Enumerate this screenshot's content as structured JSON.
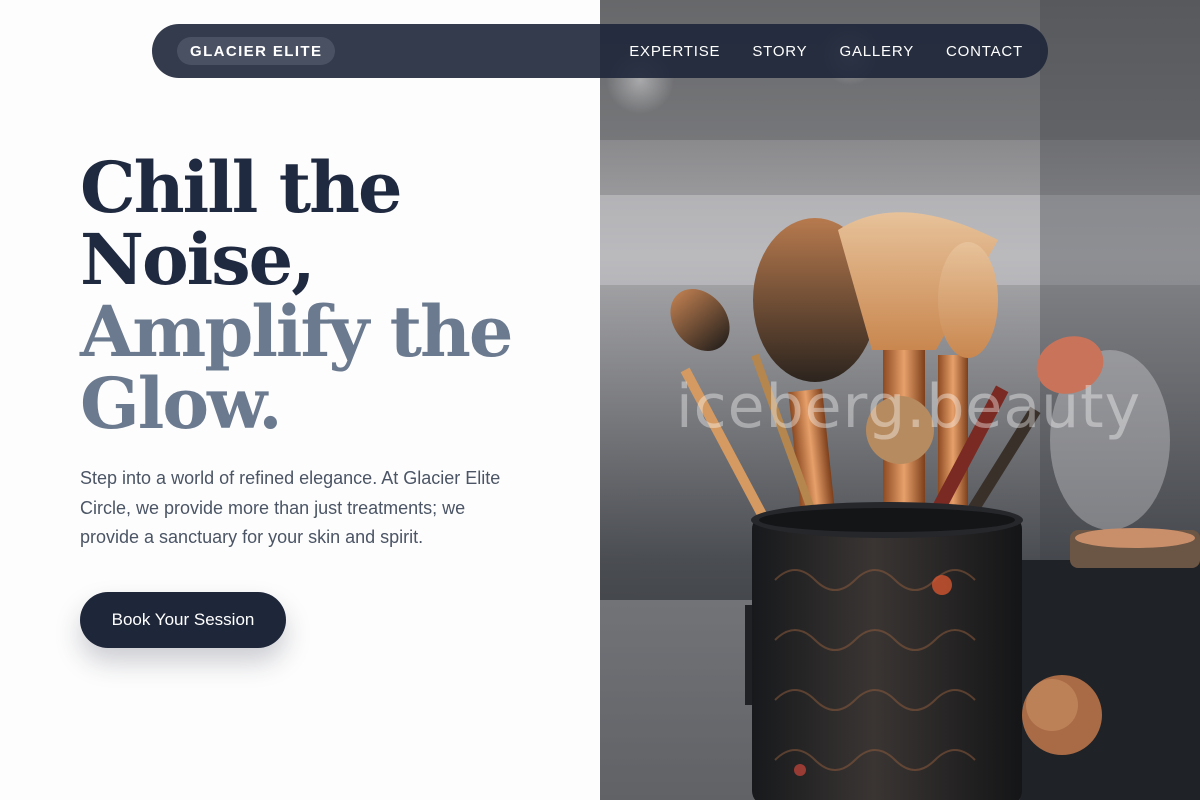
{
  "nav": {
    "brand": "GLACIER ELITE",
    "links": [
      "EXPERTISE",
      "STORY",
      "GALLERY",
      "CONTACT"
    ]
  },
  "hero": {
    "headline_lines": [
      "Chill the",
      "Noise,",
      "Amplify the",
      "Glow."
    ],
    "description": "Step into a world of refined elegance. At Glacier Elite Circle, we provide more than just treatments; we provide a sanctuary for your skin and spirit.",
    "cta_label": "Book Your Session"
  },
  "image": {
    "watermark": "iceberg.beauty",
    "subject": "makeup brushes in an ornate holder"
  },
  "colors": {
    "navy": "#1e263a",
    "headline_dark": "#1f2940",
    "headline_muted": "#6c7a90",
    "body_text": "#4b5565"
  }
}
